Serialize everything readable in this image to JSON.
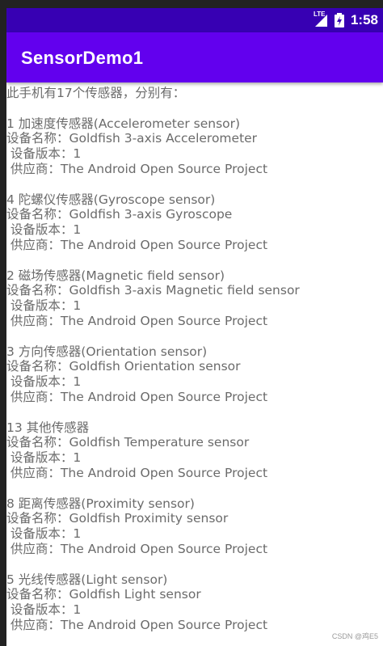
{
  "status_bar": {
    "network": "LTE",
    "time": "1:58"
  },
  "app_bar": {
    "title": "SensorDemo1"
  },
  "content": {
    "header": "此手机有17个传感器，分别有：",
    "sensors": [
      {
        "type_line": "1 加速度传感器(Accelerometer sensor)",
        "name_line": "设备名称：Goldfish 3-axis Accelerometer",
        "version_line": " 设备版本：1",
        "vendor_line": " 供应商：The Android Open Source Project"
      },
      {
        "type_line": "4 陀螺仪传感器(Gyroscope sensor)",
        "name_line": "设备名称：Goldfish 3-axis Gyroscope",
        "version_line": " 设备版本：1",
        "vendor_line": " 供应商：The Android Open Source Project"
      },
      {
        "type_line": "2 磁场传感器(Magnetic field sensor)",
        "name_line": "设备名称：Goldfish 3-axis Magnetic field sensor",
        "version_line": " 设备版本：1",
        "vendor_line": " 供应商：The Android Open Source Project"
      },
      {
        "type_line": "3 方向传感器(Orientation sensor)",
        "name_line": "设备名称：Goldfish Orientation sensor",
        "version_line": " 设备版本：1",
        "vendor_line": " 供应商：The Android Open Source Project"
      },
      {
        "type_line": "13 其他传感器",
        "name_line": "设备名称：Goldfish Temperature sensor",
        "version_line": " 设备版本：1",
        "vendor_line": " 供应商：The Android Open Source Project"
      },
      {
        "type_line": "8 距离传感器(Proximity sensor)",
        "name_line": "设备名称：Goldfish Proximity sensor",
        "version_line": " 设备版本：1",
        "vendor_line": " 供应商：The Android Open Source Project"
      },
      {
        "type_line": "5 光线传感器(Light sensor)",
        "name_line": "设备名称：Goldfish Light sensor",
        "version_line": " 设备版本：1",
        "vendor_line": " 供应商：The Android Open Source Project"
      }
    ]
  },
  "watermark": "CSDN @鸡E5",
  "colors": {
    "status_bar": "#3700b3",
    "app_bar": "#6200ee",
    "text": "#6b6b6b"
  }
}
